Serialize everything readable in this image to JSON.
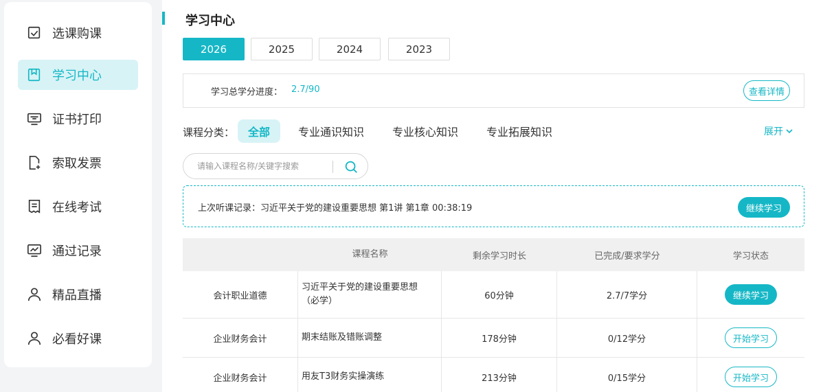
{
  "sidebar": {
    "items": [
      {
        "label": "选课购课",
        "icon": "checkbox-icon"
      },
      {
        "label": "学习中心",
        "icon": "bookmark-icon",
        "active": true
      },
      {
        "label": "证书打印",
        "icon": "monitor-print-icon"
      },
      {
        "label": "索取发票",
        "icon": "document-add-icon"
      },
      {
        "label": "在线考试",
        "icon": "exam-paper-icon"
      },
      {
        "label": "通过记录",
        "icon": "chart-monitor-icon"
      },
      {
        "label": "精品直播",
        "icon": "user-icon"
      },
      {
        "label": "必看好课",
        "icon": "user-icon"
      }
    ]
  },
  "header": {
    "title": "学习中心"
  },
  "year_tabs": [
    "2026",
    "2025",
    "2024",
    "2023"
  ],
  "progress": {
    "label": "学习总学分进度：",
    "value": "2.7/90",
    "detail_button": "查看详情"
  },
  "categories": {
    "label": "课程分类：",
    "items": [
      "全部",
      "专业通识知识",
      "专业核心知识",
      "专业拓展知识"
    ],
    "expand": "展开"
  },
  "search": {
    "placeholder": "请输入课程名称/关键字搜索"
  },
  "last_record": {
    "text": "上次听课记录：习近平关于党的建设重要思想 第1讲 第1章 00:38:19",
    "button": "继续学习"
  },
  "table": {
    "headers": [
      "",
      "课程名称",
      "剩余学习时长",
      "已完成/要求学分",
      "学习状态"
    ],
    "rows": [
      {
        "category": "会计职业道德",
        "name_line1": "习近平关于党的建设重要思想",
        "name_line2": "（必学）",
        "remaining": "60分钟",
        "credits": "2.7/7学分",
        "status": "继续学习"
      },
      {
        "category": "企业财务会计",
        "name_line1": "期末结账及错账调整",
        "name_line2": "",
        "remaining": "178分钟",
        "credits": "0/12学分",
        "status": "开始学习"
      },
      {
        "category": "企业财务会计",
        "name_line1": "用友T3财务实操演练",
        "name_line2": "",
        "remaining": "213分钟",
        "credits": "0/15学分",
        "status": "开始学习"
      }
    ]
  },
  "colors": {
    "accent": "#15b7c6",
    "active_bg": "#d8f3f6"
  }
}
